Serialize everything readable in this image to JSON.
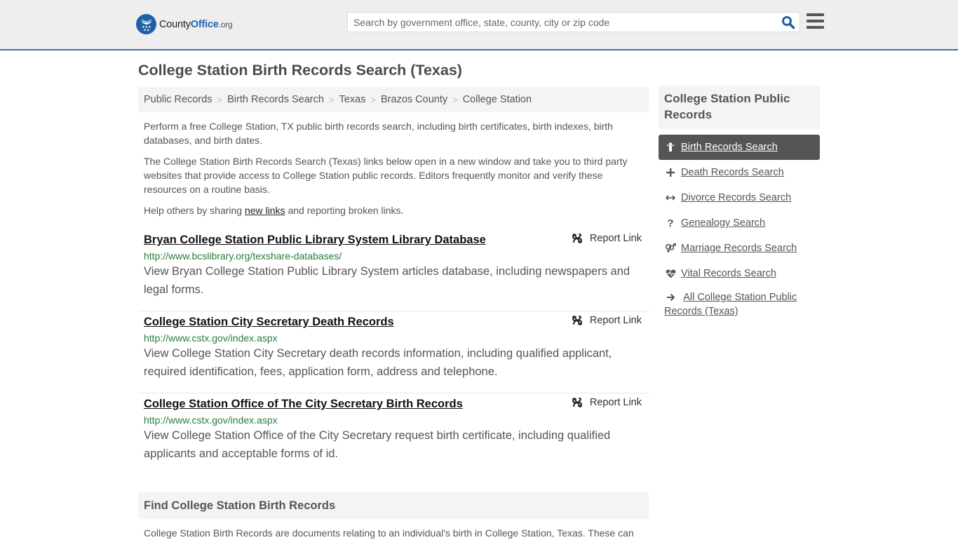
{
  "header": {
    "logo": {
      "county": "County",
      "office": "Office",
      "org": ".org",
      "icon": "eagle-stars-badge-icon"
    },
    "search": {
      "placeholder": "Search by government office, state, county, city or zip code",
      "value": "",
      "icon": "search-icon"
    },
    "menu_icon": "hamburger-menu-icon"
  },
  "colors": {
    "brand_blue": "#1f5fa8",
    "header_border": "#2e70b5",
    "url_green": "#2a7d3a",
    "active_nav": "#555555"
  },
  "page": {
    "title": "College Station Birth Records Search (Texas)"
  },
  "breadcrumb": [
    {
      "label": "Public Records"
    },
    {
      "label": "Birth Records Search"
    },
    {
      "label": "Texas"
    },
    {
      "label": "Brazos County"
    },
    {
      "label": "College Station"
    }
  ],
  "breadcrumb_separator": ">",
  "intro": {
    "p1": "Perform a free College Station, TX public birth records search, including birth certificates, birth indexes, birth databases, and birth dates.",
    "p2": "The College Station Birth Records Search (Texas) links below open in a new window and take you to third party websites that provide access to College Station public records. Editors frequently monitor and verify these resources on a routine basis.",
    "p3_before": "Help others by sharing ",
    "p3_link": "new links",
    "p3_after": " and reporting broken links."
  },
  "results": [
    {
      "title": "Bryan College Station Public Library System Library Database",
      "url": "http://www.bcslibrary.org/texshare-databases/",
      "description": "View Bryan College Station Public Library System articles database, including newspapers and legal forms.",
      "report_label": "Report Link"
    },
    {
      "title": "College Station City Secretary Death Records",
      "url": "http://www.cstx.gov/index.aspx",
      "description": "View College Station City Secretary death records information, including qualified applicant, required identification, fees, application form, address and telephone.",
      "report_label": "Report Link"
    },
    {
      "title": "College Station Office of The City Secretary Birth Records",
      "url": "http://www.cstx.gov/index.aspx",
      "description": "View College Station Office of the City Secretary request birth certificate, including qualified applicants and acceptable forms of id.",
      "report_label": "Report Link"
    }
  ],
  "find": {
    "heading": "Find College Station Birth Records",
    "text": "College Station Birth Records are documents relating to an individual's birth in College Station, Texas. These can"
  },
  "sidebar": {
    "heading": "College Station Public Records",
    "items": [
      {
        "label": "Birth Records Search",
        "icon": "baby-icon",
        "active": true
      },
      {
        "label": "Death Records Search",
        "icon": "cross-icon",
        "active": false
      },
      {
        "label": "Divorce Records Search",
        "icon": "arrows-left-right-icon",
        "active": false
      },
      {
        "label": "Genealogy Search",
        "icon": "question-icon",
        "active": false
      },
      {
        "label": "Marriage Records Search",
        "icon": "venus-mars-icon",
        "active": false
      },
      {
        "label": "Vital Records Search",
        "icon": "heartbeat-icon",
        "active": false
      },
      {
        "label": "All College Station Public Records (Texas)",
        "icon": "arrow-right-icon",
        "active": false
      }
    ]
  }
}
